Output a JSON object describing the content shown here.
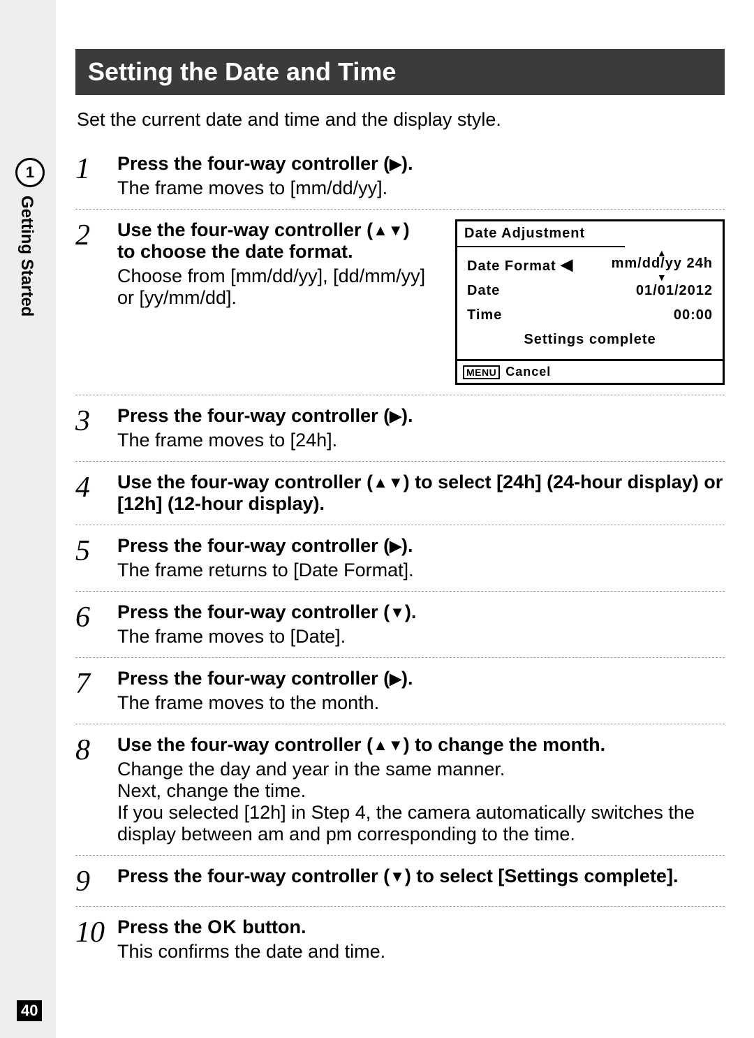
{
  "sidebar": {
    "chapter_number": "1",
    "section": "Getting Started",
    "page": "40"
  },
  "title": "Setting the Date and Time",
  "intro": "Set the current date and time and the display style.",
  "glyphs": {
    "right": "▶",
    "left": "◀",
    "up": "▲",
    "down": "▼"
  },
  "camera_screen": {
    "header": "Date Adjustment",
    "rows": {
      "format_label": "Date Format",
      "format_value": "mm/dd/yy 24h",
      "date_label": "Date",
      "date_value": "01/01/2012",
      "time_label": "Time",
      "time_value": "00:00"
    },
    "settings_complete": "Settings complete",
    "menu_chip": "MENU",
    "cancel": "Cancel"
  },
  "steps": [
    {
      "n": "1",
      "title_pre": "Press the four-way controller (",
      "title_glyph": "▶",
      "title_post": ").",
      "text": "The frame moves to [mm/dd/yy]."
    },
    {
      "n": "2",
      "title_pre": "Use the four-way controller (",
      "title_glyph": "▲▼",
      "title_post": ") to choose the date format.",
      "text": "Choose from [mm/dd/yy], [dd/mm/yy] or [yy/mm/dd]."
    },
    {
      "n": "3",
      "title_pre": "Press the four-way controller (",
      "title_glyph": "▶",
      "title_post": ").",
      "text": "The frame moves to [24h]."
    },
    {
      "n": "4",
      "title_pre": "Use the four-way controller (",
      "title_glyph": "▲▼",
      "title_post": ") to select [24h] (24-hour display) or [12h] (12-hour display).",
      "text": ""
    },
    {
      "n": "5",
      "title_pre": "Press the four-way controller (",
      "title_glyph": "▶",
      "title_post": ").",
      "text": "The frame returns to [Date Format]."
    },
    {
      "n": "6",
      "title_pre": "Press the four-way controller (",
      "title_glyph": "▼",
      "title_post": ").",
      "text": "The frame moves to [Date]."
    },
    {
      "n": "7",
      "title_pre": "Press the four-way controller (",
      "title_glyph": "▶",
      "title_post": ").",
      "text": "The frame moves to the month."
    },
    {
      "n": "8",
      "title_pre": "Use the four-way controller (",
      "title_glyph": "▲▼",
      "title_post": ") to change the month.",
      "text": "Change the day and year in the same manner.\nNext, change the time.\nIf you selected [12h] in Step 4, the camera automatically switches the display between am and pm corresponding to the time."
    },
    {
      "n": "9",
      "title_pre": "Press the four-way controller (",
      "title_glyph": "▼",
      "title_post": ") to select [Settings complete].",
      "text": ""
    },
    {
      "n": "10",
      "title_pre": "Press the ",
      "title_ok": "OK",
      "title_post": " button.",
      "text": "This confirms the date and time."
    }
  ]
}
